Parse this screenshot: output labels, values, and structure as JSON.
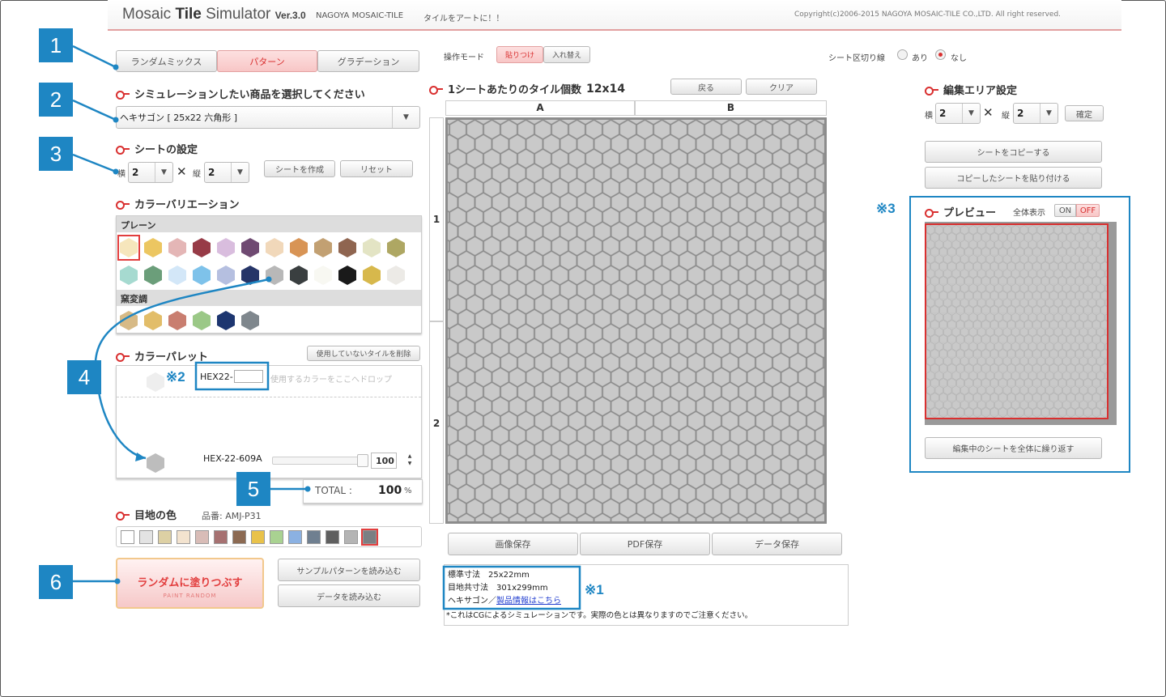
{
  "header": {
    "title_pre": "Mosaic ",
    "title_bold": "Tile",
    "title_post": " Simulator",
    "version": "Ver.3.0",
    "brand": "NAGOYA MOSAIC-TILE",
    "tagline": "タイルをアートに！！",
    "copyright": "Copyright(c)2006-2015 NAGOYA MOSAIC-TILE CO.,LTD. All right reserved."
  },
  "tabs": [
    {
      "label": "ランダムミックス"
    },
    {
      "label": "パターン"
    },
    {
      "label": "グラデーション"
    }
  ],
  "product": {
    "heading": "シミュレーションしたい商品を選択してください",
    "value": "ヘキサゴン [ 25x22 六角形 ]"
  },
  "sheet_settings": {
    "heading": "シートの設定",
    "w_label": "横",
    "w_value": "2",
    "x": "✕",
    "h_label": "縦",
    "h_value": "2",
    "create": "シートを作成",
    "reset": "リセット"
  },
  "color_variation": {
    "heading": "カラーバリエーション",
    "plain_label": "プレーン",
    "kiln_label": "窯変調",
    "plain_row1": [
      "#f6e6bc",
      "#ecc661",
      "#e4b6b6",
      "#973b47",
      "#d9bdde",
      "#6f4a72",
      "#f1d8ba",
      "#d89455",
      "#c2a072",
      "#8f6550",
      "#e3e4c4",
      "#aea763"
    ],
    "plain_row2": [
      "#a6dad0",
      "#6b9e7a",
      "#d3e7f8",
      "#7ec2ea",
      "#b5bfe0",
      "#263568",
      "#b8b8b8",
      "#3a3f40",
      "#f8f8f2",
      "#1a1a1a",
      "#d7b84c",
      "#eceae6"
    ],
    "kiln_row": [
      "#d7ba86",
      "#e2bd69",
      "#c97e70",
      "#9bc887",
      "#1d3670",
      "#7f878d"
    ]
  },
  "palette": {
    "heading": "カラーパレット",
    "remove_unused": "使用していないタイルを削除",
    "slot_code": "HEX22-",
    "drop_hint": "使用するカラーをここへドロップ",
    "item_code": "HEX-22-609A",
    "item_percent": "100",
    "total_label": "TOTAL :",
    "total_value": "100",
    "total_unit": "%"
  },
  "grout": {
    "heading": "目地の色",
    "code": "品番: AMJ-P31",
    "colors": [
      "#ffffff",
      "#e3e3e3",
      "#ddd0a4",
      "#f3e3cf",
      "#d8bcb7",
      "#a67171",
      "#8c6a52",
      "#e9c24a",
      "#a9d291",
      "#8bb1e2",
      "#6f7f90",
      "#5f5f5f",
      "#b4b4b4",
      "#7b7f83"
    ]
  },
  "actions": {
    "random_fill": "ランダムに塗りつぶす",
    "random_fill_en": "PAINT RANDOM",
    "load_sample": "サンプルパターンを読み込む",
    "load_data": "データを読み込む"
  },
  "mode": {
    "label": "操作モード",
    "paste": "貼りつけ",
    "replace": "入れ替え"
  },
  "sheet_line": {
    "label": "シート区切り線",
    "on": "あり",
    "off": "なし"
  },
  "canvas": {
    "heading": "1シートあたりのタイル個数",
    "count": "12x14",
    "back": "戻る",
    "clear": "クリア",
    "col_a": "A",
    "col_b": "B",
    "row_1": "1",
    "row_2": "2"
  },
  "save": {
    "image": "画像保存",
    "pdf": "PDF保存",
    "data": "データ保存"
  },
  "info": {
    "size": "標準寸法　25x22mm",
    "joint": "目地共寸法　301x299mm",
    "type": "ヘキサゴン／",
    "link": "製品情報はこちら",
    "disclaimer": "*これはCGによるシミュレーションです。実際の色とは異なりますのでご注意ください。"
  },
  "edit_area": {
    "heading": "編集エリア設定",
    "w_label": "横",
    "w_value": "2",
    "x": "✕",
    "h_label": "縦",
    "h_value": "2",
    "confirm": "確定",
    "copy": "シートをコピーする",
    "paste": "コピーしたシートを貼り付ける"
  },
  "preview": {
    "heading": "プレビュー",
    "full_label": "全体表示",
    "on": "ON",
    "off": "OFF",
    "repeat": "編集中のシートを全体に繰り返す"
  },
  "callouts": {
    "b1": "1",
    "b2": "2",
    "b3": "3",
    "b4": "4",
    "b5": "5",
    "b6": "6",
    "n1": "※1",
    "n2": "※2",
    "n3": "※3"
  },
  "colors": {
    "accent": "#1e86c3",
    "red": "#d93030",
    "tile": "#c9c9c9",
    "grid_bg": "#8c8c8c"
  }
}
